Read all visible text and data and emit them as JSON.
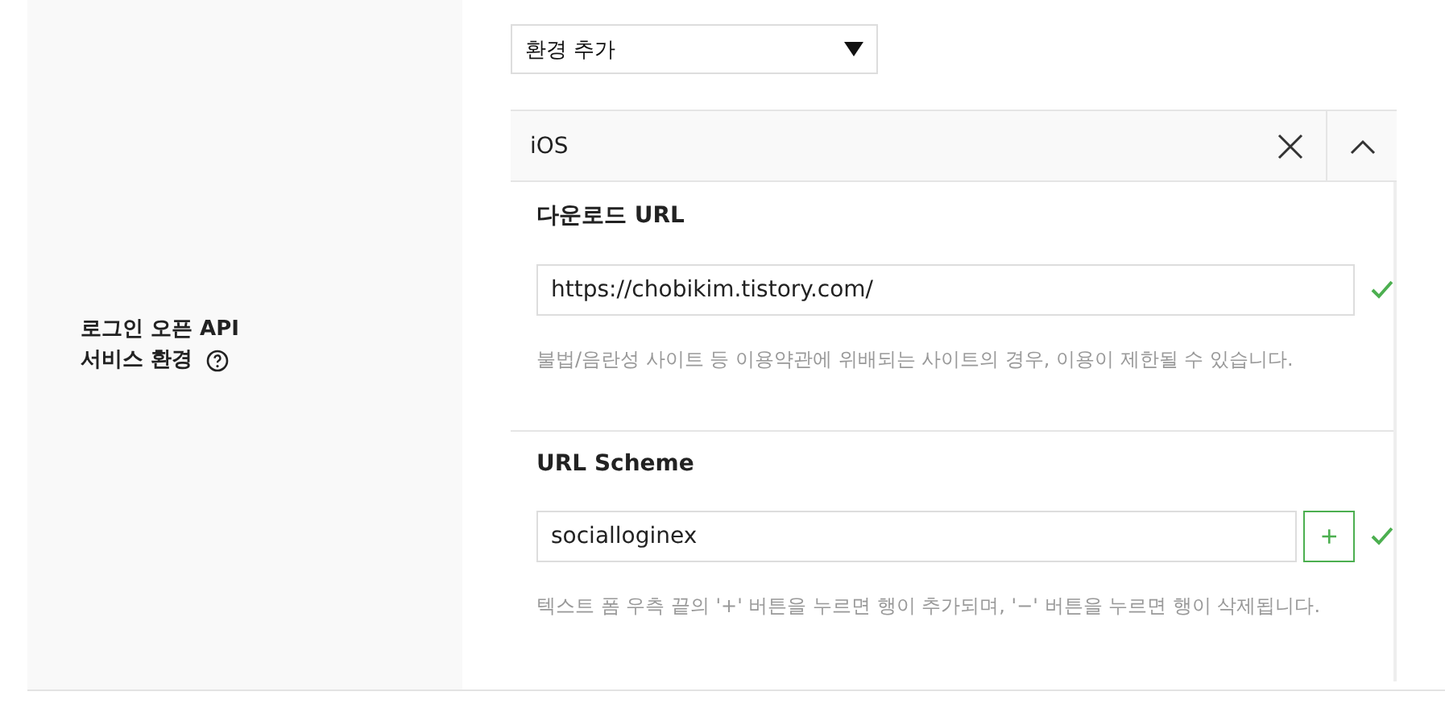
{
  "setting_label": {
    "lines": [
      "로그인 오픈 API",
      "서비스 환경"
    ]
  },
  "environment_select": {
    "value": "환경 추가"
  },
  "panel": {
    "title": "iOS",
    "expanded": true
  },
  "fields": [
    {
      "kind": "plain",
      "label": "다운로드 URL",
      "value": "https://chobikim.tistory.com/",
      "valid": true,
      "hint": "불법/음란성 사이트 등 이용약관에 위배되는 사이트의 경우, 이용이 제한될 수 있습니다."
    },
    {
      "kind": "addable",
      "label": "URL Scheme",
      "value": "socialloginex",
      "valid": true,
      "add_label": "+",
      "hint": "텍스트 폼 우측 끝의 '+' 버튼을 누르면 행이 추가되며, '−' 버튼을 누르면 행이 삭제됩니다."
    }
  ]
}
